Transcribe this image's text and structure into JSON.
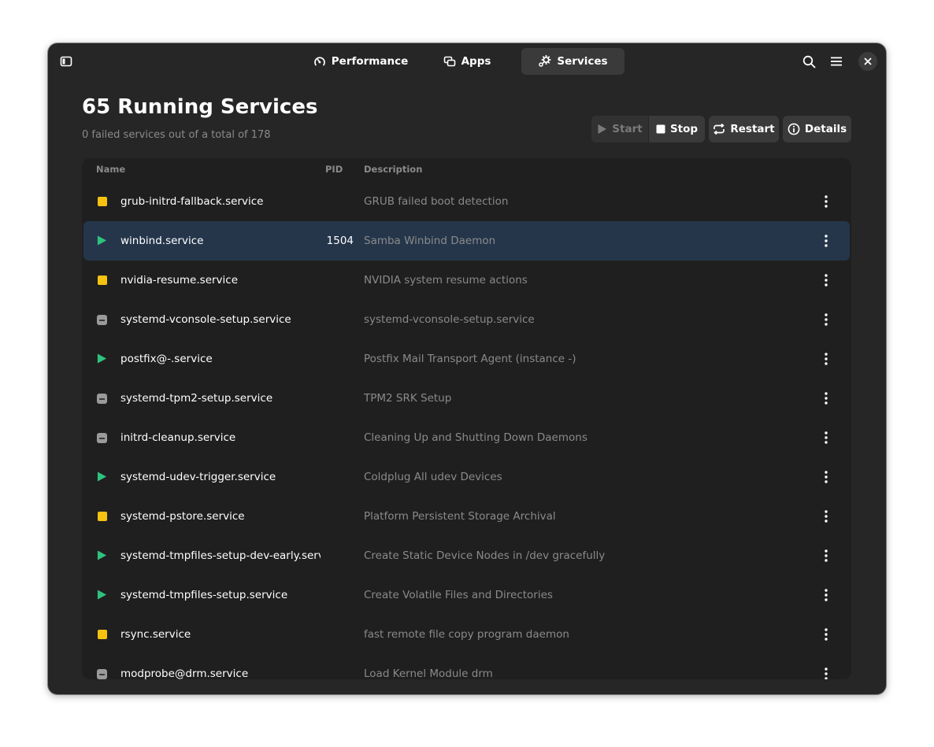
{
  "header": {
    "tabs": [
      {
        "label": "Performance",
        "icon": "speedometer-icon",
        "active": false
      },
      {
        "label": "Apps",
        "icon": "apps-icon",
        "active": false
      },
      {
        "label": "Services",
        "icon": "gears-icon",
        "active": true
      }
    ]
  },
  "main": {
    "title": "65 Running Services",
    "subtitle": "0 failed services out of a total of 178",
    "actions": {
      "start_label": "Start",
      "stop_label": "Stop",
      "restart_label": "Restart",
      "details_label": "Details"
    },
    "columns": {
      "name": "Name",
      "pid": "PID",
      "description": "Description"
    },
    "services": [
      {
        "name": "grub-initrd-fallback.service",
        "pid": "",
        "description": "GRUB failed boot detection",
        "status": "stopped"
      },
      {
        "name": "winbind.service",
        "pid": "1504",
        "description": "Samba Winbind Daemon",
        "status": "running",
        "selected": true
      },
      {
        "name": "nvidia-resume.service",
        "pid": "",
        "description": "NVIDIA system resume actions",
        "status": "stopped"
      },
      {
        "name": "systemd-vconsole-setup.service",
        "pid": "",
        "description": "systemd-vconsole-setup.service",
        "status": "inactive"
      },
      {
        "name": "postfix@-.service",
        "pid": "",
        "description": "Postfix Mail Transport Agent (instance -)",
        "status": "running"
      },
      {
        "name": "systemd-tpm2-setup.service",
        "pid": "",
        "description": "TPM2 SRK Setup",
        "status": "inactive"
      },
      {
        "name": "initrd-cleanup.service",
        "pid": "",
        "description": "Cleaning Up and Shutting Down Daemons",
        "status": "inactive"
      },
      {
        "name": "systemd-udev-trigger.service",
        "pid": "",
        "description": "Coldplug All udev Devices",
        "status": "running"
      },
      {
        "name": "systemd-pstore.service",
        "pid": "",
        "description": "Platform Persistent Storage Archival",
        "status": "stopped"
      },
      {
        "name": "systemd-tmpfiles-setup-dev-early.servi",
        "pid": "",
        "description": "Create Static Device Nodes in /dev gracefully",
        "status": "running"
      },
      {
        "name": "systemd-tmpfiles-setup.service",
        "pid": "",
        "description": "Create Volatile Files and Directories",
        "status": "running"
      },
      {
        "name": "rsync.service",
        "pid": "",
        "description": "fast remote file copy program daemon",
        "status": "stopped"
      },
      {
        "name": "modprobe@drm.service",
        "pid": "",
        "description": "Load Kernel Module drm",
        "status": "inactive"
      }
    ]
  },
  "colors": {
    "running": "#2ec27e",
    "stopped": "#f5c211",
    "inactive": "#9a9a9a",
    "selected_row": "#25364b"
  }
}
